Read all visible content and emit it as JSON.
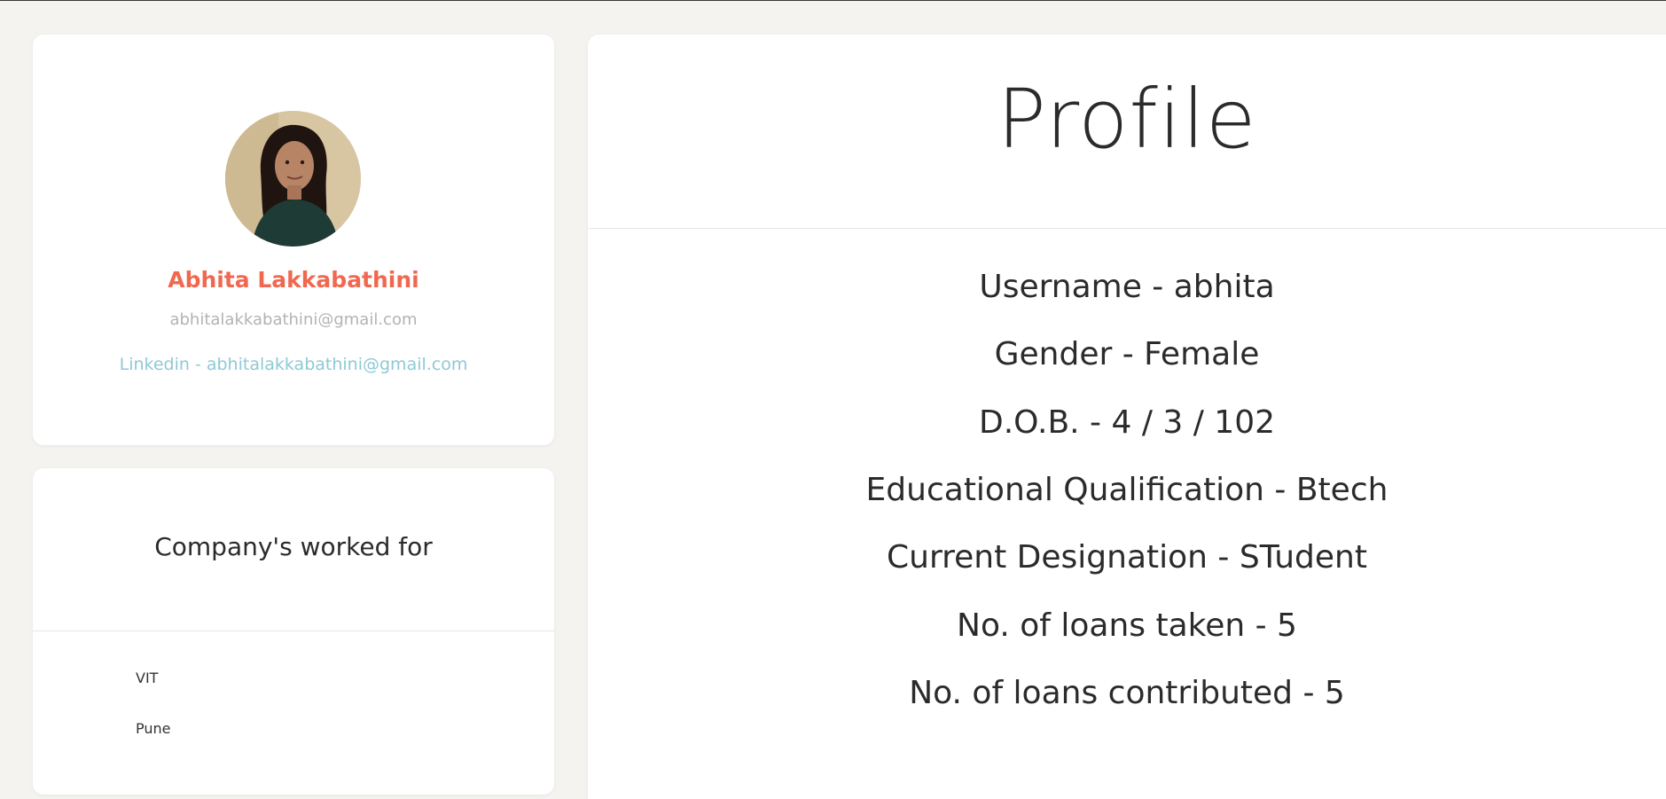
{
  "profile": {
    "avatar_icon": "user-photo-icon",
    "name": "Abhita Lakkabathini",
    "email": "abhitalakkabathini@gmail.com",
    "linkedin": "Linkedin - abhitalakkabathini@gmail.com"
  },
  "companies": {
    "title": "Company's worked for",
    "items": [
      "VIT",
      "Pune"
    ]
  },
  "main": {
    "title": "Profile",
    "details": [
      "Username - abhita",
      "Gender - Female",
      "D.O.B. - 4 / 3 / 102",
      "Educational Qualification - Btech",
      "Current Designation - STudent",
      "No. of loans taken - 5",
      "No. of loans contributed - 5"
    ]
  },
  "colors": {
    "background": "#f4f3f0",
    "name_accent": "#f0684f",
    "linkedin": "#8ec9d6",
    "email": "#b3b3b3"
  }
}
